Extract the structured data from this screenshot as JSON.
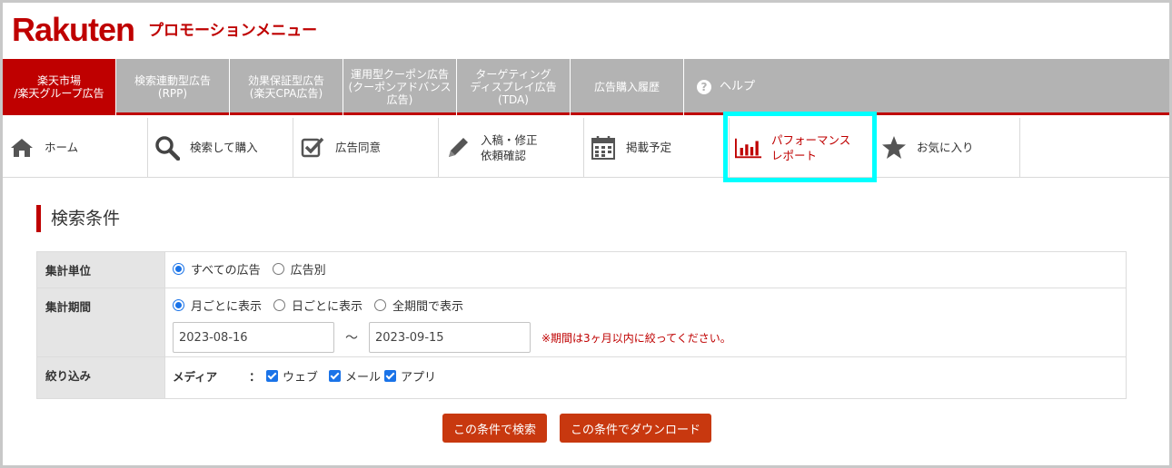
{
  "header": {
    "logo": "Rakuten",
    "title": "プロモーションメニュー"
  },
  "topnav": {
    "tabs": [
      {
        "label": "楽天市場\n/楽天グループ広告"
      },
      {
        "label": "検索連動型広告\n(RPP)"
      },
      {
        "label": "効果保証型広告\n(楽天CPA広告)"
      },
      {
        "label": "運用型クーポン広告\n(クーポンアドバンス\n広告)"
      },
      {
        "label": "ターゲティング\nディスプレイ広告\n(TDA)"
      },
      {
        "label": "広告購入履歴"
      },
      {
        "label": "ヘルプ"
      }
    ]
  },
  "subnav": {
    "items": [
      {
        "label": "ホーム",
        "icon": "home-icon"
      },
      {
        "label": "検索して購入",
        "icon": "search-icon"
      },
      {
        "label": "広告同意",
        "icon": "checkbox-icon"
      },
      {
        "label": "入稿・修正\n依頼確認",
        "icon": "pencil-icon"
      },
      {
        "label": "掲載予定",
        "icon": "calendar-icon"
      },
      {
        "label": "パフォーマンス\nレポート",
        "icon": "bar-chart-icon"
      },
      {
        "label": "お気に入り",
        "icon": "star-icon"
      }
    ]
  },
  "section": {
    "title": "検索条件"
  },
  "form": {
    "unit": {
      "label": "集計単位",
      "options": [
        "すべての広告",
        "広告別"
      ],
      "selected": "すべての広告"
    },
    "period": {
      "label": "集計期間",
      "options": [
        "月ごとに表示",
        "日ごとに表示",
        "全期間で表示"
      ],
      "selected": "月ごとに表示",
      "start": "2023-08-16",
      "tilde": "～",
      "end": "2023-09-15",
      "note": "※期間は3ヶ月以内に絞ってください。"
    },
    "filter": {
      "label": "絞り込み",
      "media_label": "メディア",
      "colon": "：",
      "options": [
        "ウェブ",
        "メール",
        "アプリ"
      ]
    }
  },
  "buttons": {
    "search": "この条件で検索",
    "download": "この条件でダウンロード"
  },
  "colors": {
    "brand": "#bf0000",
    "nav_grey": "#b3b3b3",
    "highlight": "#00ffff",
    "button": "#c8380f"
  }
}
